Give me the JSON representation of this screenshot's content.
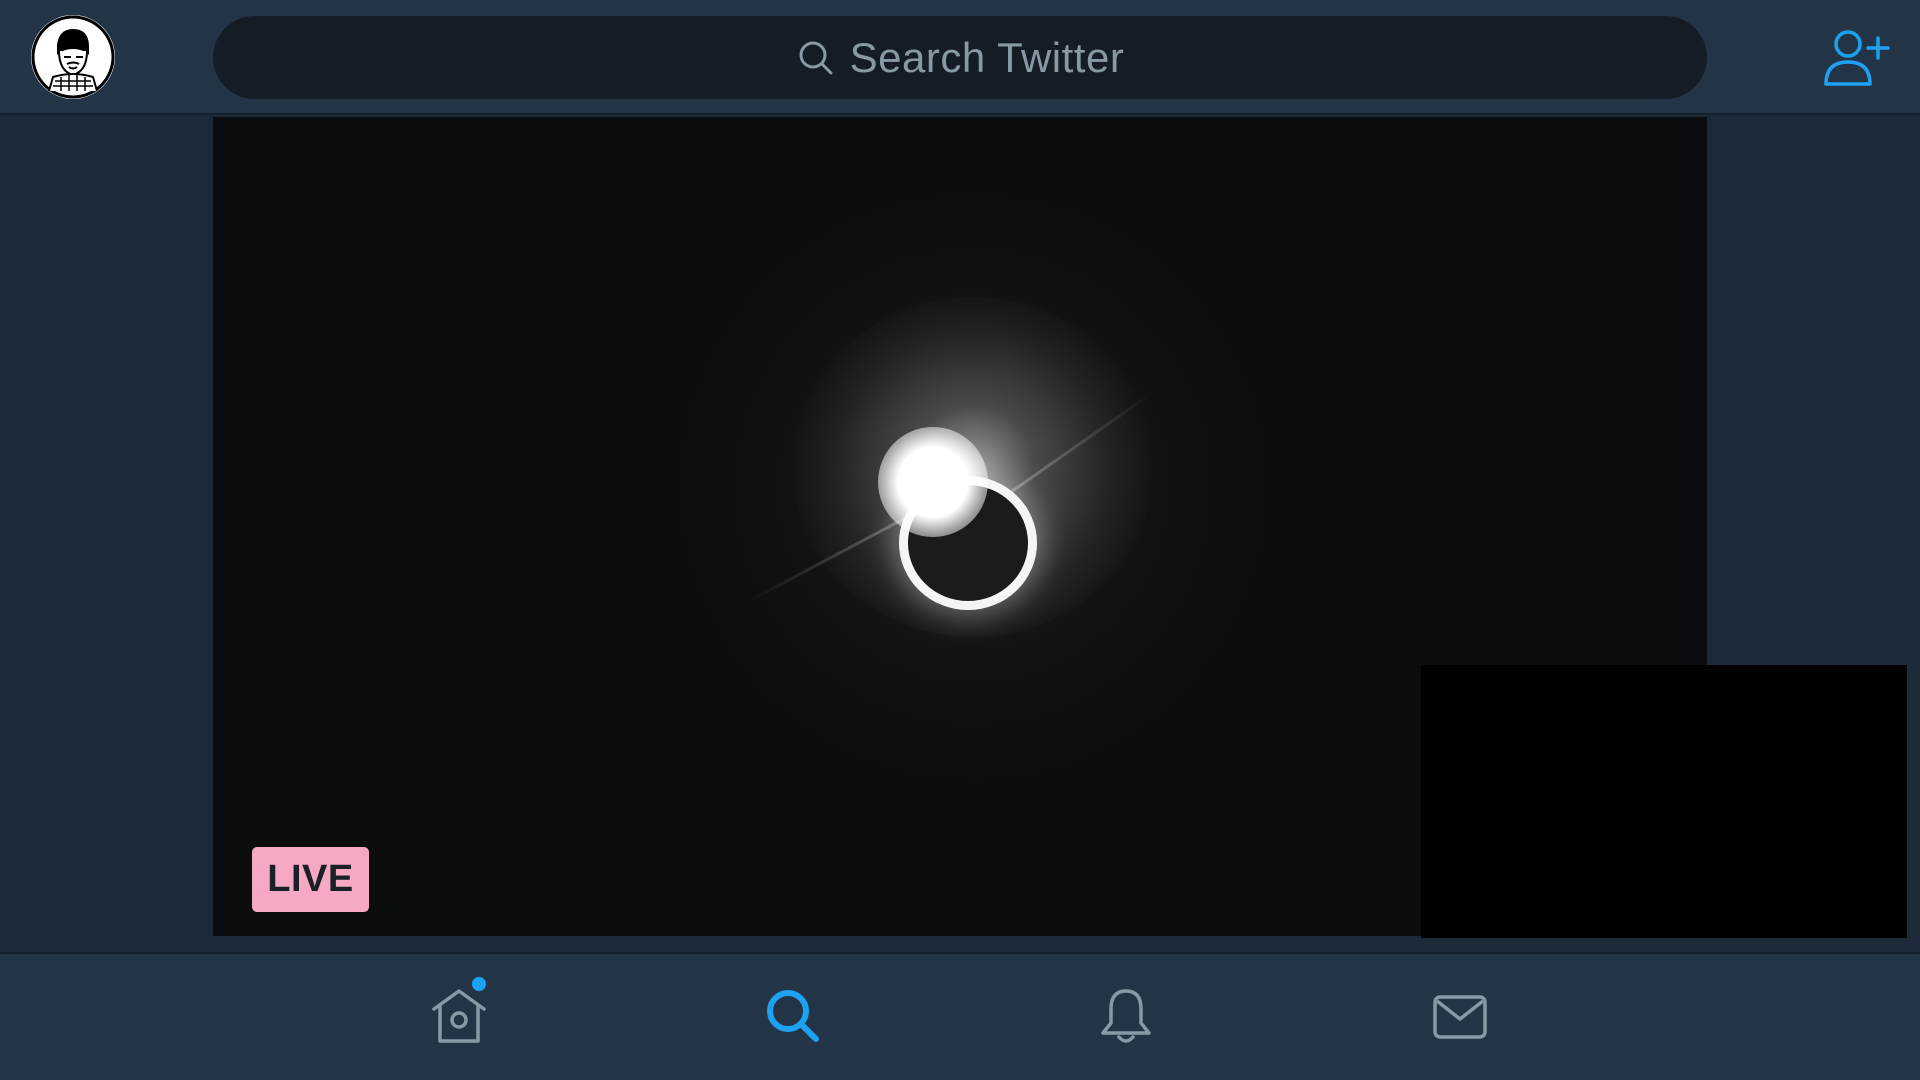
{
  "header": {
    "search": {
      "placeholder": "Search Twitter"
    },
    "icons": {
      "avatar": "profile-avatar",
      "add_user": "add-user-icon"
    }
  },
  "video": {
    "live_label": "LIVE",
    "content": "total solar eclipse diamond ring"
  },
  "tabbar": {
    "items": [
      {
        "name": "home",
        "icon": "home-icon",
        "active": false,
        "has_notification_dot": true
      },
      {
        "name": "explore",
        "icon": "search-icon",
        "active": true
      },
      {
        "name": "notifications",
        "icon": "bell-icon",
        "active": false
      },
      {
        "name": "messages",
        "icon": "mail-icon",
        "active": false
      }
    ]
  },
  "colors": {
    "accent": "#1da1f2",
    "bar_background": "#243447",
    "page_background": "#1d2a3a",
    "live_badge": "#f7a8c4",
    "icon_inactive": "#8899a6"
  }
}
